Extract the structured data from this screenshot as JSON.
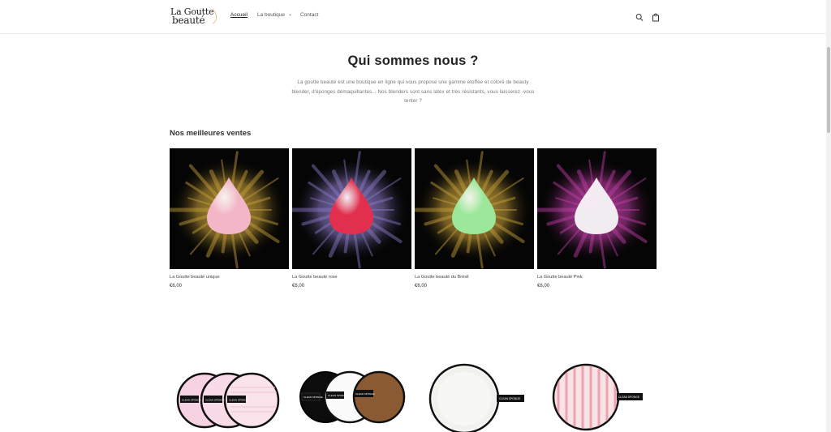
{
  "header": {
    "logo_line1": "La Goutte",
    "logo_line2": "beauté",
    "nav": [
      {
        "label": "Accueil"
      },
      {
        "label": "La boutique"
      },
      {
        "label": "Contact"
      }
    ],
    "icons": [
      "search-icon",
      "cart-icon"
    ]
  },
  "intro": {
    "title": "Qui sommes nous ?",
    "text": "La goutte beauté est une boutique en ligne qui vous propose une gamme étoffée et coloré de beauty blender, d'éponges démaquillantes... Nos blenders sont sans latex et très résistants, vous laisserez -vous tenter ?"
  },
  "bestsellers": {
    "title": "Nos meilleures ventes",
    "products": [
      {
        "name": "La Goutte beauté unique",
        "price": "€6,00",
        "color": "#f3b6c8",
        "splash": "#c9a23a"
      },
      {
        "name": "La Goutte beauté rose",
        "price": "€6,00",
        "color": "#e0304d",
        "splash": "#8b7bc7"
      },
      {
        "name": "La Goutte beauté du Brésil",
        "price": "€6,00",
        "color": "#9be89a",
        "splash": "#c9a23a"
      },
      {
        "name": "La Goutte beauté Pink",
        "price": "€6,00",
        "color": "#f1ecef",
        "splash": "#c23fa8"
      }
    ]
  },
  "pads": {
    "label": "CLEAN SPONGE"
  }
}
